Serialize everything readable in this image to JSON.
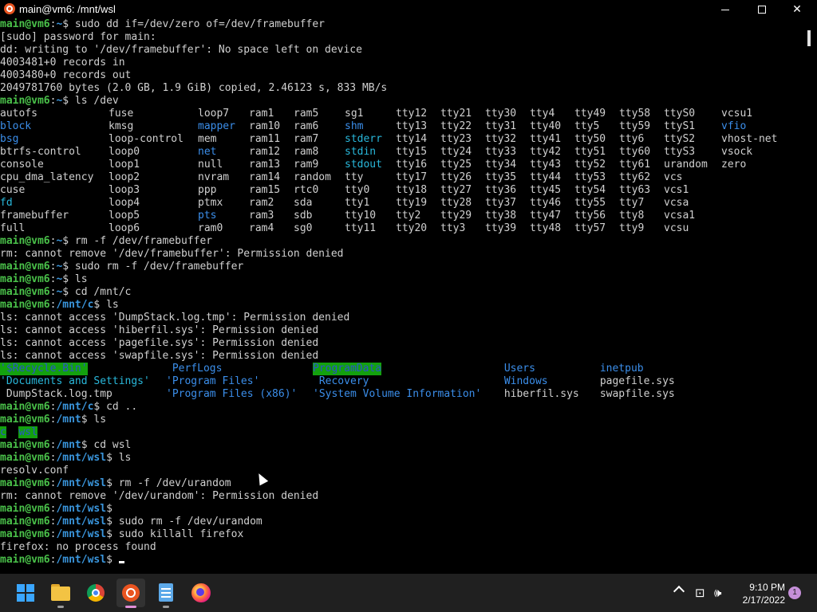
{
  "window": {
    "title": "main@vm6: /mnt/wsl",
    "minimize_icon": "minimize-icon",
    "maximize_icon": "maximize-icon",
    "close_icon": "close-icon"
  },
  "terminal": {
    "lines": [
      {
        "segs": [
          {
            "t": "main@vm6",
            "k": "p-user"
          },
          {
            "t": ":",
            "k": "p-white"
          },
          {
            "t": "~",
            "k": "p-path"
          },
          {
            "t": "$ sudo dd if=/dev/zero of=/dev/framebuffer",
            "k": "p-white"
          }
        ]
      },
      {
        "segs": [
          {
            "t": "[sudo] password for main:"
          }
        ]
      },
      {
        "segs": [
          {
            "t": "dd: writing to '/dev/framebuffer': No space left on device"
          }
        ]
      },
      {
        "segs": [
          {
            "t": "4003481+0 records in"
          }
        ]
      },
      {
        "segs": [
          {
            "t": "4003480+0 records out"
          }
        ]
      },
      {
        "segs": [
          {
            "t": "2049781760 bytes (2.0 GB, 1.9 GiB) copied, 2.46123 s, 833 MB/s"
          }
        ]
      },
      {
        "segs": [
          {
            "t": "main@vm6",
            "k": "p-user"
          },
          {
            "t": ":",
            "k": "p-white"
          },
          {
            "t": "~",
            "k": "p-path"
          },
          {
            "t": "$ ls /dev",
            "k": "p-white"
          }
        ]
      },
      {
        "cols": [
          "autofs",
          "fuse",
          "loop7",
          "ram1",
          "ram5",
          "sg1",
          "tty12",
          "tty21",
          "tty30",
          "tty4",
          "tty49",
          "tty58",
          "ttyS0",
          "vcsu1"
        ],
        "colors": [
          "",
          "",
          "",
          "",
          "",
          "",
          "",
          "",
          "",
          "",
          "",
          "",
          "",
          ""
        ]
      },
      {
        "cols": [
          "block",
          "kmsg",
          "mapper",
          "ram10",
          "ram6",
          "shm",
          "tty13",
          "tty22",
          "tty31",
          "tty40",
          "tty5",
          "tty59",
          "ttyS1",
          "vfio"
        ],
        "colors": [
          "blue",
          "",
          "blue",
          "",
          "",
          "blue",
          "",
          "",
          "",
          "",
          "",
          "",
          "",
          "blue"
        ]
      },
      {
        "cols": [
          "bsg",
          "loop-control",
          "mem",
          "ram11",
          "ram7",
          "stderr",
          "tty14",
          "tty23",
          "tty32",
          "tty41",
          "tty50",
          "tty6",
          "ttyS2",
          "vhost-net"
        ],
        "colors": [
          "blue",
          "",
          "",
          "",
          "",
          "cyan",
          "",
          "",
          "",
          "",
          "",
          "",
          "",
          ""
        ]
      },
      {
        "cols": [
          "btrfs-control",
          "loop0",
          "net",
          "ram12",
          "ram8",
          "stdin",
          "tty15",
          "tty24",
          "tty33",
          "tty42",
          "tty51",
          "tty60",
          "ttyS3",
          "vsock"
        ],
        "colors": [
          "",
          "",
          "blue",
          "",
          "",
          "cyan",
          "",
          "",
          "",
          "",
          "",
          "",
          "",
          ""
        ]
      },
      {
        "cols": [
          "console",
          "loop1",
          "null",
          "ram13",
          "ram9",
          "stdout",
          "tty16",
          "tty25",
          "tty34",
          "tty43",
          "tty52",
          "tty61",
          "urandom",
          "zero"
        ],
        "colors": [
          "",
          "",
          "",
          "",
          "",
          "cyan",
          "",
          "",
          "",
          "",
          "",
          "",
          "",
          ""
        ]
      },
      {
        "cols": [
          "cpu_dma_latency",
          "loop2",
          "nvram",
          "ram14",
          "random",
          "tty",
          "tty17",
          "tty26",
          "tty35",
          "tty44",
          "tty53",
          "tty62",
          "vcs",
          ""
        ],
        "colors": [
          "",
          "",
          "",
          "",
          "",
          "",
          "",
          "",
          "",
          "",
          "",
          "",
          "",
          ""
        ]
      },
      {
        "cols": [
          "cuse",
          "loop3",
          "ppp",
          "ram15",
          "rtc0",
          "tty0",
          "tty18",
          "tty27",
          "tty36",
          "tty45",
          "tty54",
          "tty63",
          "vcs1",
          ""
        ],
        "colors": [
          "",
          "",
          "",
          "",
          "",
          "",
          "",
          "",
          "",
          "",
          "",
          "",
          "",
          ""
        ]
      },
      {
        "cols": [
          "fd",
          "loop4",
          "ptmx",
          "ram2",
          "sda",
          "tty1",
          "tty19",
          "tty28",
          "tty37",
          "tty46",
          "tty55",
          "tty7",
          "vcsa",
          ""
        ],
        "colors": [
          "cyan",
          "",
          "",
          "",
          "",
          "",
          "",
          "",
          "",
          "",
          "",
          "",
          "",
          ""
        ]
      },
      {
        "cols": [
          "framebuffer",
          "loop5",
          "pts",
          "ram3",
          "sdb",
          "tty10",
          "tty2",
          "tty29",
          "tty38",
          "tty47",
          "tty56",
          "tty8",
          "vcsa1",
          ""
        ],
        "colors": [
          "",
          "",
          "blue",
          "",
          "",
          "",
          "",
          "",
          "",
          "",
          "",
          "",
          "",
          ""
        ]
      },
      {
        "cols": [
          "full",
          "loop6",
          "ram0",
          "ram4",
          "sg0",
          "tty11",
          "tty20",
          "tty3",
          "tty39",
          "tty48",
          "tty57",
          "tty9",
          "vcsu",
          ""
        ],
        "colors": [
          "",
          "",
          "",
          "",
          "",
          "",
          "",
          "",
          "",
          "",
          "",
          "",
          "",
          ""
        ]
      },
      {
        "segs": [
          {
            "t": "main@vm6",
            "k": "p-user"
          },
          {
            "t": ":",
            "k": "p-white"
          },
          {
            "t": "~",
            "k": "p-path"
          },
          {
            "t": "$ rm -f /dev/framebuffer",
            "k": "p-white"
          }
        ]
      },
      {
        "segs": [
          {
            "t": "rm: cannot remove '/dev/framebuffer': Permission denied"
          }
        ]
      },
      {
        "segs": [
          {
            "t": "main@vm6",
            "k": "p-user"
          },
          {
            "t": ":",
            "k": "p-white"
          },
          {
            "t": "~",
            "k": "p-path"
          },
          {
            "t": "$ sudo rm -f /dev/framebuffer",
            "k": "p-white"
          }
        ]
      },
      {
        "segs": [
          {
            "t": "main@vm6",
            "k": "p-user"
          },
          {
            "t": ":",
            "k": "p-white"
          },
          {
            "t": "~",
            "k": "p-path"
          },
          {
            "t": "$ ls",
            "k": "p-white"
          }
        ]
      },
      {
        "segs": [
          {
            "t": "main@vm6",
            "k": "p-user"
          },
          {
            "t": ":",
            "k": "p-white"
          },
          {
            "t": "~",
            "k": "p-path"
          },
          {
            "t": "$ cd /mnt/c",
            "k": "p-white"
          }
        ]
      },
      {
        "segs": [
          {
            "t": "main@vm6",
            "k": "p-user"
          },
          {
            "t": ":",
            "k": "p-white"
          },
          {
            "t": "/mnt/c",
            "k": "p-path"
          },
          {
            "t": "$ ls",
            "k": "p-white"
          }
        ]
      },
      {
        "segs": [
          {
            "t": "ls: cannot access 'DumpStack.log.tmp': Permission denied"
          }
        ]
      },
      {
        "segs": [
          {
            "t": "ls: cannot access 'hiberfil.sys': Permission denied"
          }
        ]
      },
      {
        "segs": [
          {
            "t": "ls: cannot access 'pagefile.sys': Permission denied"
          }
        ]
      },
      {
        "segs": [
          {
            "t": "ls: cannot access 'swapfile.sys': Permission denied"
          }
        ]
      },
      {
        "wide": [
          {
            "t": "'$Recycle.Bin'",
            "k": "greenbg",
            "col": 0
          },
          {
            "t": " PerfLogs",
            "k": "blue",
            "col": 1
          },
          {
            "t": "ProgramData",
            "k": "greenbg",
            "col": 2
          },
          {
            "t": " Users",
            "k": "blue",
            "col": 3
          },
          {
            "t": " inetpub",
            "k": "blue",
            "col": 4
          }
        ]
      },
      {
        "wide": [
          {
            "t": "'Documents and Settings'",
            "k": "cyan",
            "col": 0
          },
          {
            "t": "'Program Files'",
            "k": "blue",
            "col": 1
          },
          {
            "t": " Recovery",
            "k": "blue",
            "col": 2
          },
          {
            "t": " Windows",
            "k": "blue",
            "col": 3
          },
          {
            "t": " pagefile.sys",
            "k": "",
            "col": 4
          }
        ]
      },
      {
        "wide": [
          {
            "t": " DumpStack.log.tmp",
            "k": "",
            "col": 0
          },
          {
            "t": "'Program Files (x86)'",
            "k": "blue",
            "col": 1
          },
          {
            "t": "'System Volume Information'",
            "k": "blue",
            "col": 2
          },
          {
            "t": " hiberfil.sys",
            "k": "",
            "col": 3
          },
          {
            "t": " swapfile.sys",
            "k": "",
            "col": 4
          }
        ]
      },
      {
        "segs": [
          {
            "t": "main@vm6",
            "k": "p-user"
          },
          {
            "t": ":",
            "k": "p-white"
          },
          {
            "t": "/mnt/c",
            "k": "p-path"
          },
          {
            "t": "$ cd ..",
            "k": "p-white"
          }
        ]
      },
      {
        "segs": [
          {
            "t": "main@vm6",
            "k": "p-user"
          },
          {
            "t": ":",
            "k": "p-white"
          },
          {
            "t": "/mnt",
            "k": "p-path"
          },
          {
            "t": "$ ls",
            "k": "p-white"
          }
        ]
      },
      {
        "segs": [
          {
            "t": "c",
            "k": "greenbg"
          },
          {
            "t": "  "
          },
          {
            "t": "wsl",
            "k": "greenbg"
          }
        ]
      },
      {
        "segs": [
          {
            "t": "main@vm6",
            "k": "p-user"
          },
          {
            "t": ":",
            "k": "p-white"
          },
          {
            "t": "/mnt",
            "k": "p-path"
          },
          {
            "t": "$ cd wsl",
            "k": "p-white"
          }
        ]
      },
      {
        "segs": [
          {
            "t": "main@vm6",
            "k": "p-user"
          },
          {
            "t": ":",
            "k": "p-white"
          },
          {
            "t": "/mnt/wsl",
            "k": "p-path"
          },
          {
            "t": "$ ls",
            "k": "p-white"
          }
        ]
      },
      {
        "segs": [
          {
            "t": "resolv.conf"
          }
        ]
      },
      {
        "segs": [
          {
            "t": "main@vm6",
            "k": "p-user"
          },
          {
            "t": ":",
            "k": "p-white"
          },
          {
            "t": "/mnt/wsl",
            "k": "p-path"
          },
          {
            "t": "$ rm -f /dev/urandom",
            "k": "p-white"
          }
        ]
      },
      {
        "segs": [
          {
            "t": "rm: cannot remove '/dev/urandom': Permission denied"
          }
        ]
      },
      {
        "segs": [
          {
            "t": "main@vm6",
            "k": "p-user"
          },
          {
            "t": ":",
            "k": "p-white"
          },
          {
            "t": "/mnt/wsl",
            "k": "p-path"
          },
          {
            "t": "$",
            "k": "p-white"
          }
        ]
      },
      {
        "segs": [
          {
            "t": "main@vm6",
            "k": "p-user"
          },
          {
            "t": ":",
            "k": "p-white"
          },
          {
            "t": "/mnt/wsl",
            "k": "p-path"
          },
          {
            "t": "$ sudo rm -f /dev/urandom",
            "k": "p-white"
          }
        ]
      },
      {
        "segs": [
          {
            "t": "main@vm6",
            "k": "p-user"
          },
          {
            "t": ":",
            "k": "p-white"
          },
          {
            "t": "/mnt/wsl",
            "k": "p-path"
          },
          {
            "t": "$ sudo killall firefox",
            "k": "p-white"
          }
        ]
      },
      {
        "segs": [
          {
            "t": "firefox: no process found"
          }
        ]
      },
      {
        "segs": [
          {
            "t": "main@vm6",
            "k": "p-user"
          },
          {
            "t": ":",
            "k": "p-white"
          },
          {
            "t": "/mnt/wsl",
            "k": "p-path"
          },
          {
            "t": "$ ",
            "k": "p-white"
          }
        ],
        "cursor": true
      }
    ]
  },
  "taskbar": {
    "items": [
      {
        "name": "start-button",
        "icon": "windows-logo-icon",
        "active": false,
        "open": false
      },
      {
        "name": "file-explorer-button",
        "icon": "folder-icon",
        "active": false,
        "open": true
      },
      {
        "name": "chrome-button",
        "icon": "chrome-icon",
        "active": false,
        "open": false
      },
      {
        "name": "ubuntu-terminal-button",
        "icon": "ubuntu-icon",
        "active": true,
        "open": true
      },
      {
        "name": "notepad-button",
        "icon": "notepad-icon",
        "active": false,
        "open": true
      },
      {
        "name": "firefox-button",
        "icon": "firefox-icon",
        "active": false,
        "open": false
      }
    ],
    "tray": {
      "time": "9:10 PM",
      "date": "2/17/2022",
      "notification_count": "1"
    }
  }
}
